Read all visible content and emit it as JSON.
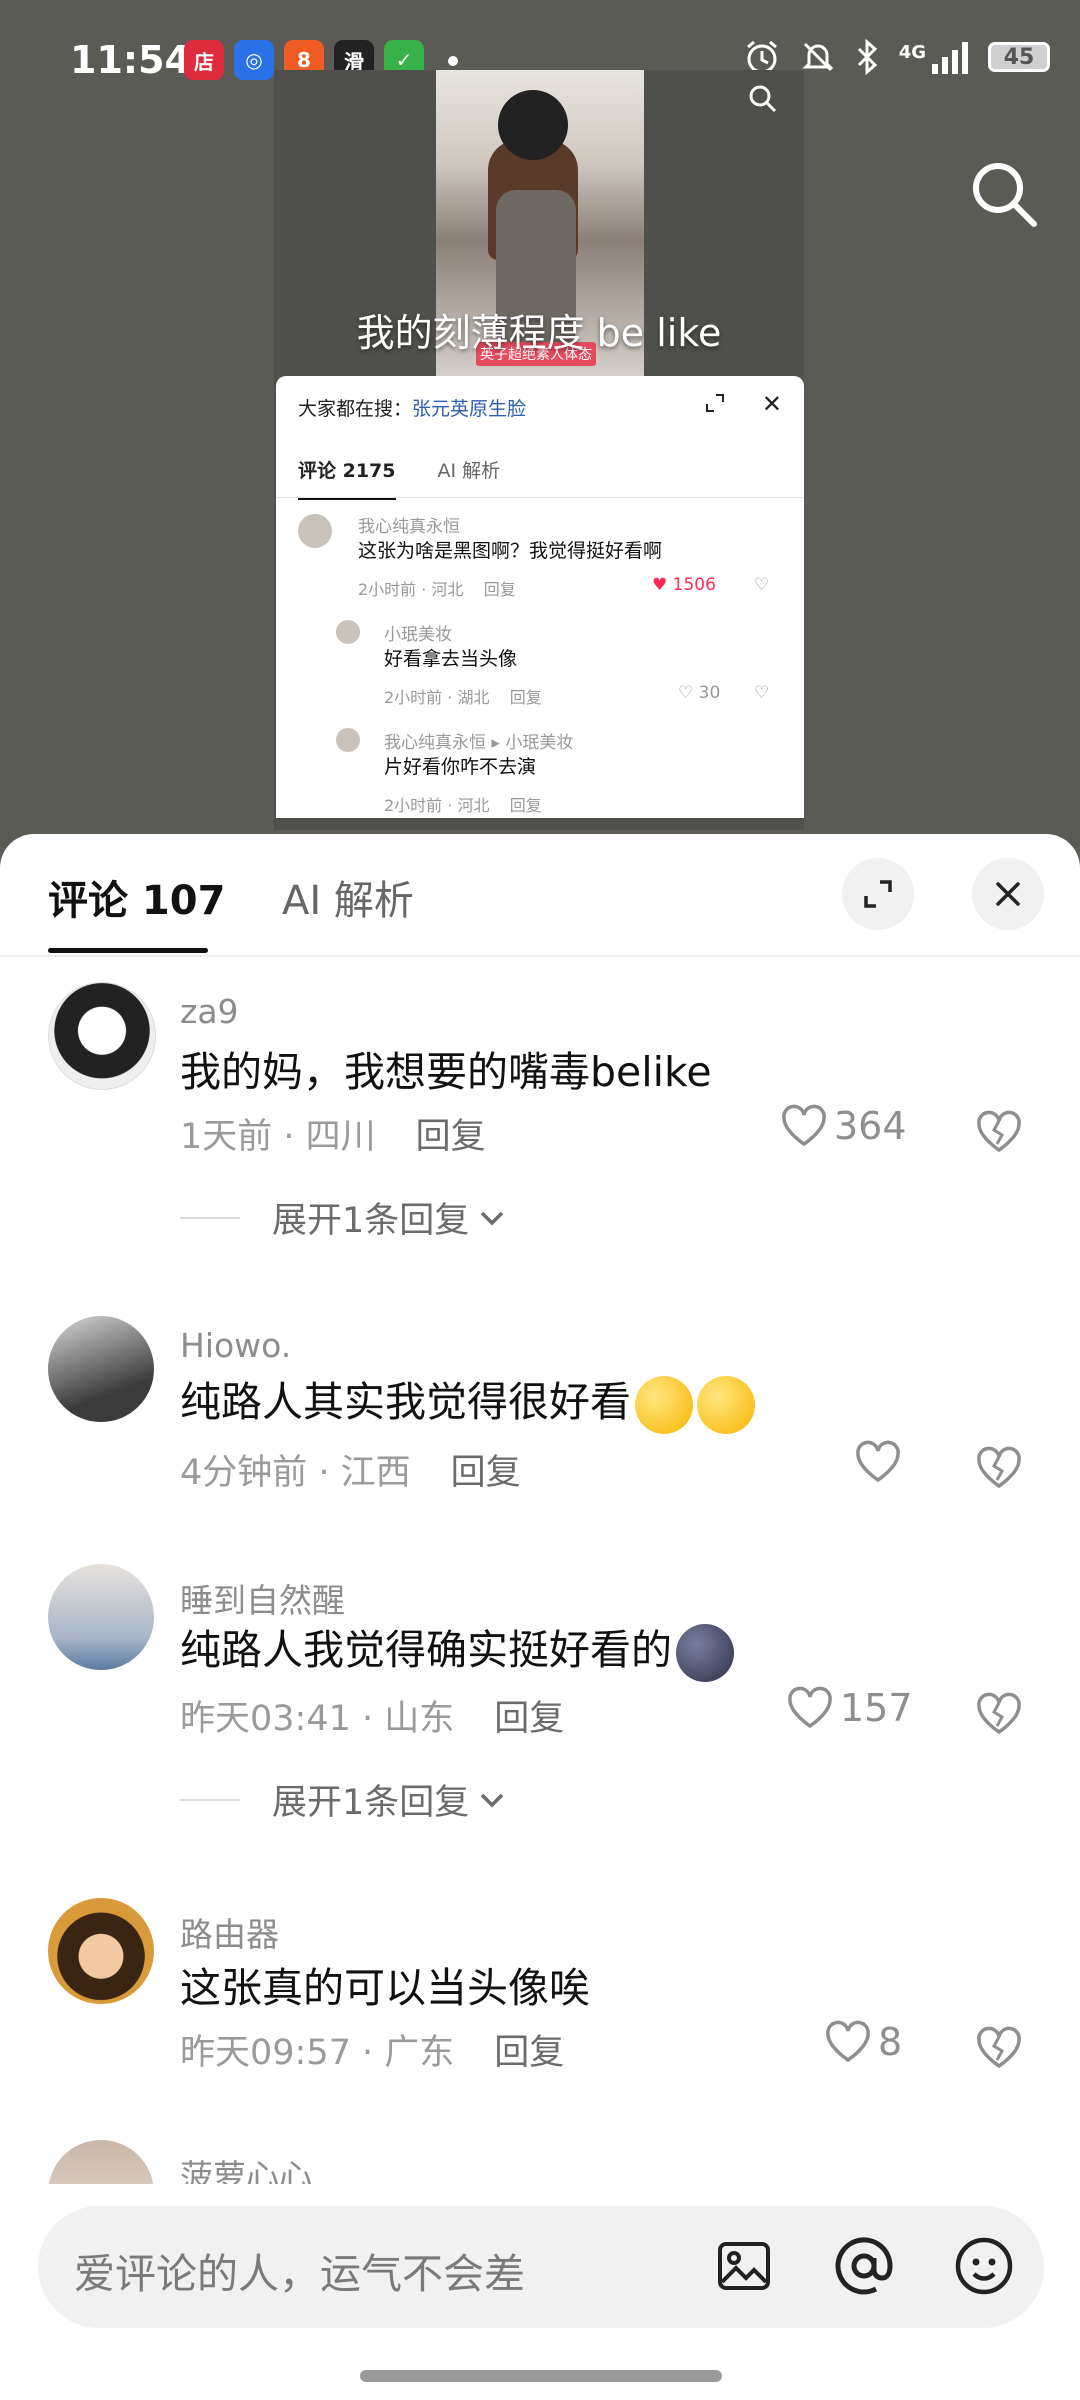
{
  "status_bar": {
    "time": "11:54",
    "app_icons": [
      {
        "name": "store-app-icon",
        "label": "店",
        "color": "#e02b3c"
      },
      {
        "name": "map-app-icon",
        "label": "◎",
        "color": "#2a72e8"
      },
      {
        "name": "games-app-icon",
        "label": "8",
        "color": "#f05a23"
      },
      {
        "name": "news-app-icon",
        "label": "滑",
        "color": "#222222"
      },
      {
        "name": "security-app-icon",
        "label": "✓",
        "color": "#38b24a"
      }
    ],
    "network": "4G",
    "battery": "45"
  },
  "video": {
    "photo_tag": "英子超绝素人体态",
    "caption": "我的刻薄程度 be like"
  },
  "mini_card": {
    "search_prefix": "大家都在搜：",
    "search_term": "张元英原生脸",
    "tab_comments": "评论 2175",
    "tab_ai": "AI 解析",
    "c1_name": "我心纯真永恒",
    "c1_text": "这张为啥是黑图啊？我觉得挺好看啊",
    "c1_meta": "2小时前 · 河北",
    "c1_reply": "回复",
    "c1_likes": "1506",
    "c2_name": "小珉美妆",
    "c2_text": "好看拿去当头像",
    "c2_meta": "2小时前 · 湖北",
    "c2_reply": "回复",
    "c2_likes": "30",
    "c3_name": "我心纯真永恒 ▸ 小珉美妆",
    "c3_text": "片好看你咋不去演",
    "c3_meta": "2小时前 · 河北",
    "c3_reply": "回复"
  },
  "sheet": {
    "tab_comments": "评论 107",
    "tab_ai": "AI 解析",
    "comments": [
      {
        "user": "za9",
        "text": "我的妈，我想要的嘴毒belike",
        "time_loc": "1天前 · 四川",
        "reply": "回复",
        "likes": "364",
        "expand": "展开1条回复"
      },
      {
        "user": "Hiowo.",
        "text": "纯路人其实我觉得很好看",
        "time_loc": "4分钟前 · 江西",
        "reply": "回复",
        "likes": ""
      },
      {
        "user": "睡到自然醒",
        "text": "纯路人我觉得确实挺好看的",
        "time_loc": "昨天03:41 · 山东",
        "reply": "回复",
        "likes": "157",
        "expand": "展开1条回复"
      },
      {
        "user": "路由器",
        "text": "这张真的可以当头像唉",
        "time_loc": "昨天09:57 · 广东",
        "reply": "回复",
        "likes": "8"
      },
      {
        "user": "菠萝心心"
      }
    ]
  },
  "input": {
    "placeholder": "爱评论的人，运气不会差"
  }
}
